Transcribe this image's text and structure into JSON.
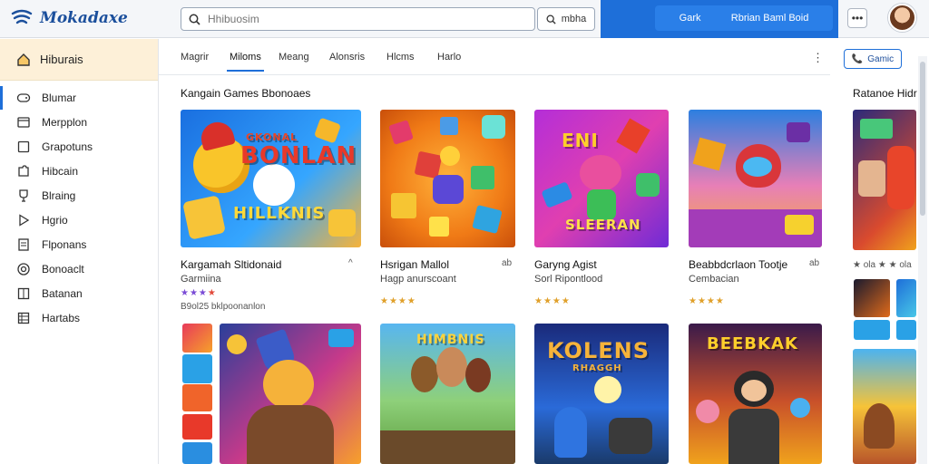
{
  "app": {
    "name": "Mokadaxe",
    "logo_icon": "wifi-waves-icon"
  },
  "search": {
    "placeholder": "Hhibuosim",
    "button_label": "mbha"
  },
  "header": {
    "left_link": "Gark",
    "right_link": "Rbrian Baml Boid",
    "more_icon": "ellipsis-icon",
    "colors": {
      "accent": "#1e6fd9",
      "band": "#1e6fd9"
    }
  },
  "sidebar": {
    "home_label": "Hiburais",
    "items": [
      {
        "label": "Blumar",
        "icon": "gamepad-icon"
      },
      {
        "label": "Merpplon",
        "icon": "card-icon"
      },
      {
        "label": "Grapotuns",
        "icon": "square-icon"
      },
      {
        "label": "Hibcain",
        "icon": "puzzle-icon"
      },
      {
        "label": "Blraing",
        "icon": "trophy-icon"
      },
      {
        "label": "Hgrio",
        "icon": "play-icon"
      },
      {
        "label": "Flponans",
        "icon": "document-icon"
      },
      {
        "label": "Bonoaclt",
        "icon": "target-icon"
      },
      {
        "label": "Batanan",
        "icon": "grid-icon"
      },
      {
        "label": "Hartabs",
        "icon": "table-icon"
      }
    ]
  },
  "tabs": [
    "Magrir",
    "Miloms",
    "Meang",
    "Alonsris",
    "Hlcms",
    "Harlo"
  ],
  "toolbar": {
    "games_button": "Gamic",
    "games_icon": "phone-icon",
    "kebab_icon": "vertical-dots-icon"
  },
  "sections": {
    "main_title": "Kangain Games Bbonoaes",
    "side_title": "Ratanoe Hidr"
  },
  "cards": [
    {
      "art_title": "BONLAN",
      "art_subtitle": "HILLKNIS",
      "art_banner": "GKONAL",
      "title": "Kargamah Sltidonaid",
      "subtitle": "Garmiina",
      "rating": 3,
      "meta": "B9ol25 bklpoonanlon",
      "action_icon": "caret-up-icon"
    },
    {
      "art_title": "",
      "title": "Hsrigan Mallol",
      "subtitle": "Hagp anurscoant",
      "rating": 4,
      "action": "ab",
      "action_icon": "link-icon"
    },
    {
      "art_title": "ENI",
      "art_subtitle": "SLEERAN",
      "title": "Garyng Agist",
      "subtitle": "Sorl Ripontlood",
      "rating": 4,
      "action": "ab",
      "action_icon": "link-icon"
    },
    {
      "art_title": "",
      "title": "Beabbdcrlaon Tootje",
      "subtitle": "Cembacian",
      "rating": 3,
      "action": "ab",
      "action_icon": "link-icon"
    },
    {
      "art_title": "HIMBNIS",
      "title": "",
      "subtitle": "",
      "rating": 0
    },
    {
      "art_title": "KOLENS",
      "art_subtitle": "RHAGGH",
      "title": "",
      "subtitle": "",
      "rating": 0
    },
    {
      "art_title": "BEEBKAK",
      "title": "",
      "subtitle": "",
      "rating": 0
    }
  ],
  "side_rating_text": "★ ola ★ ★ ola"
}
